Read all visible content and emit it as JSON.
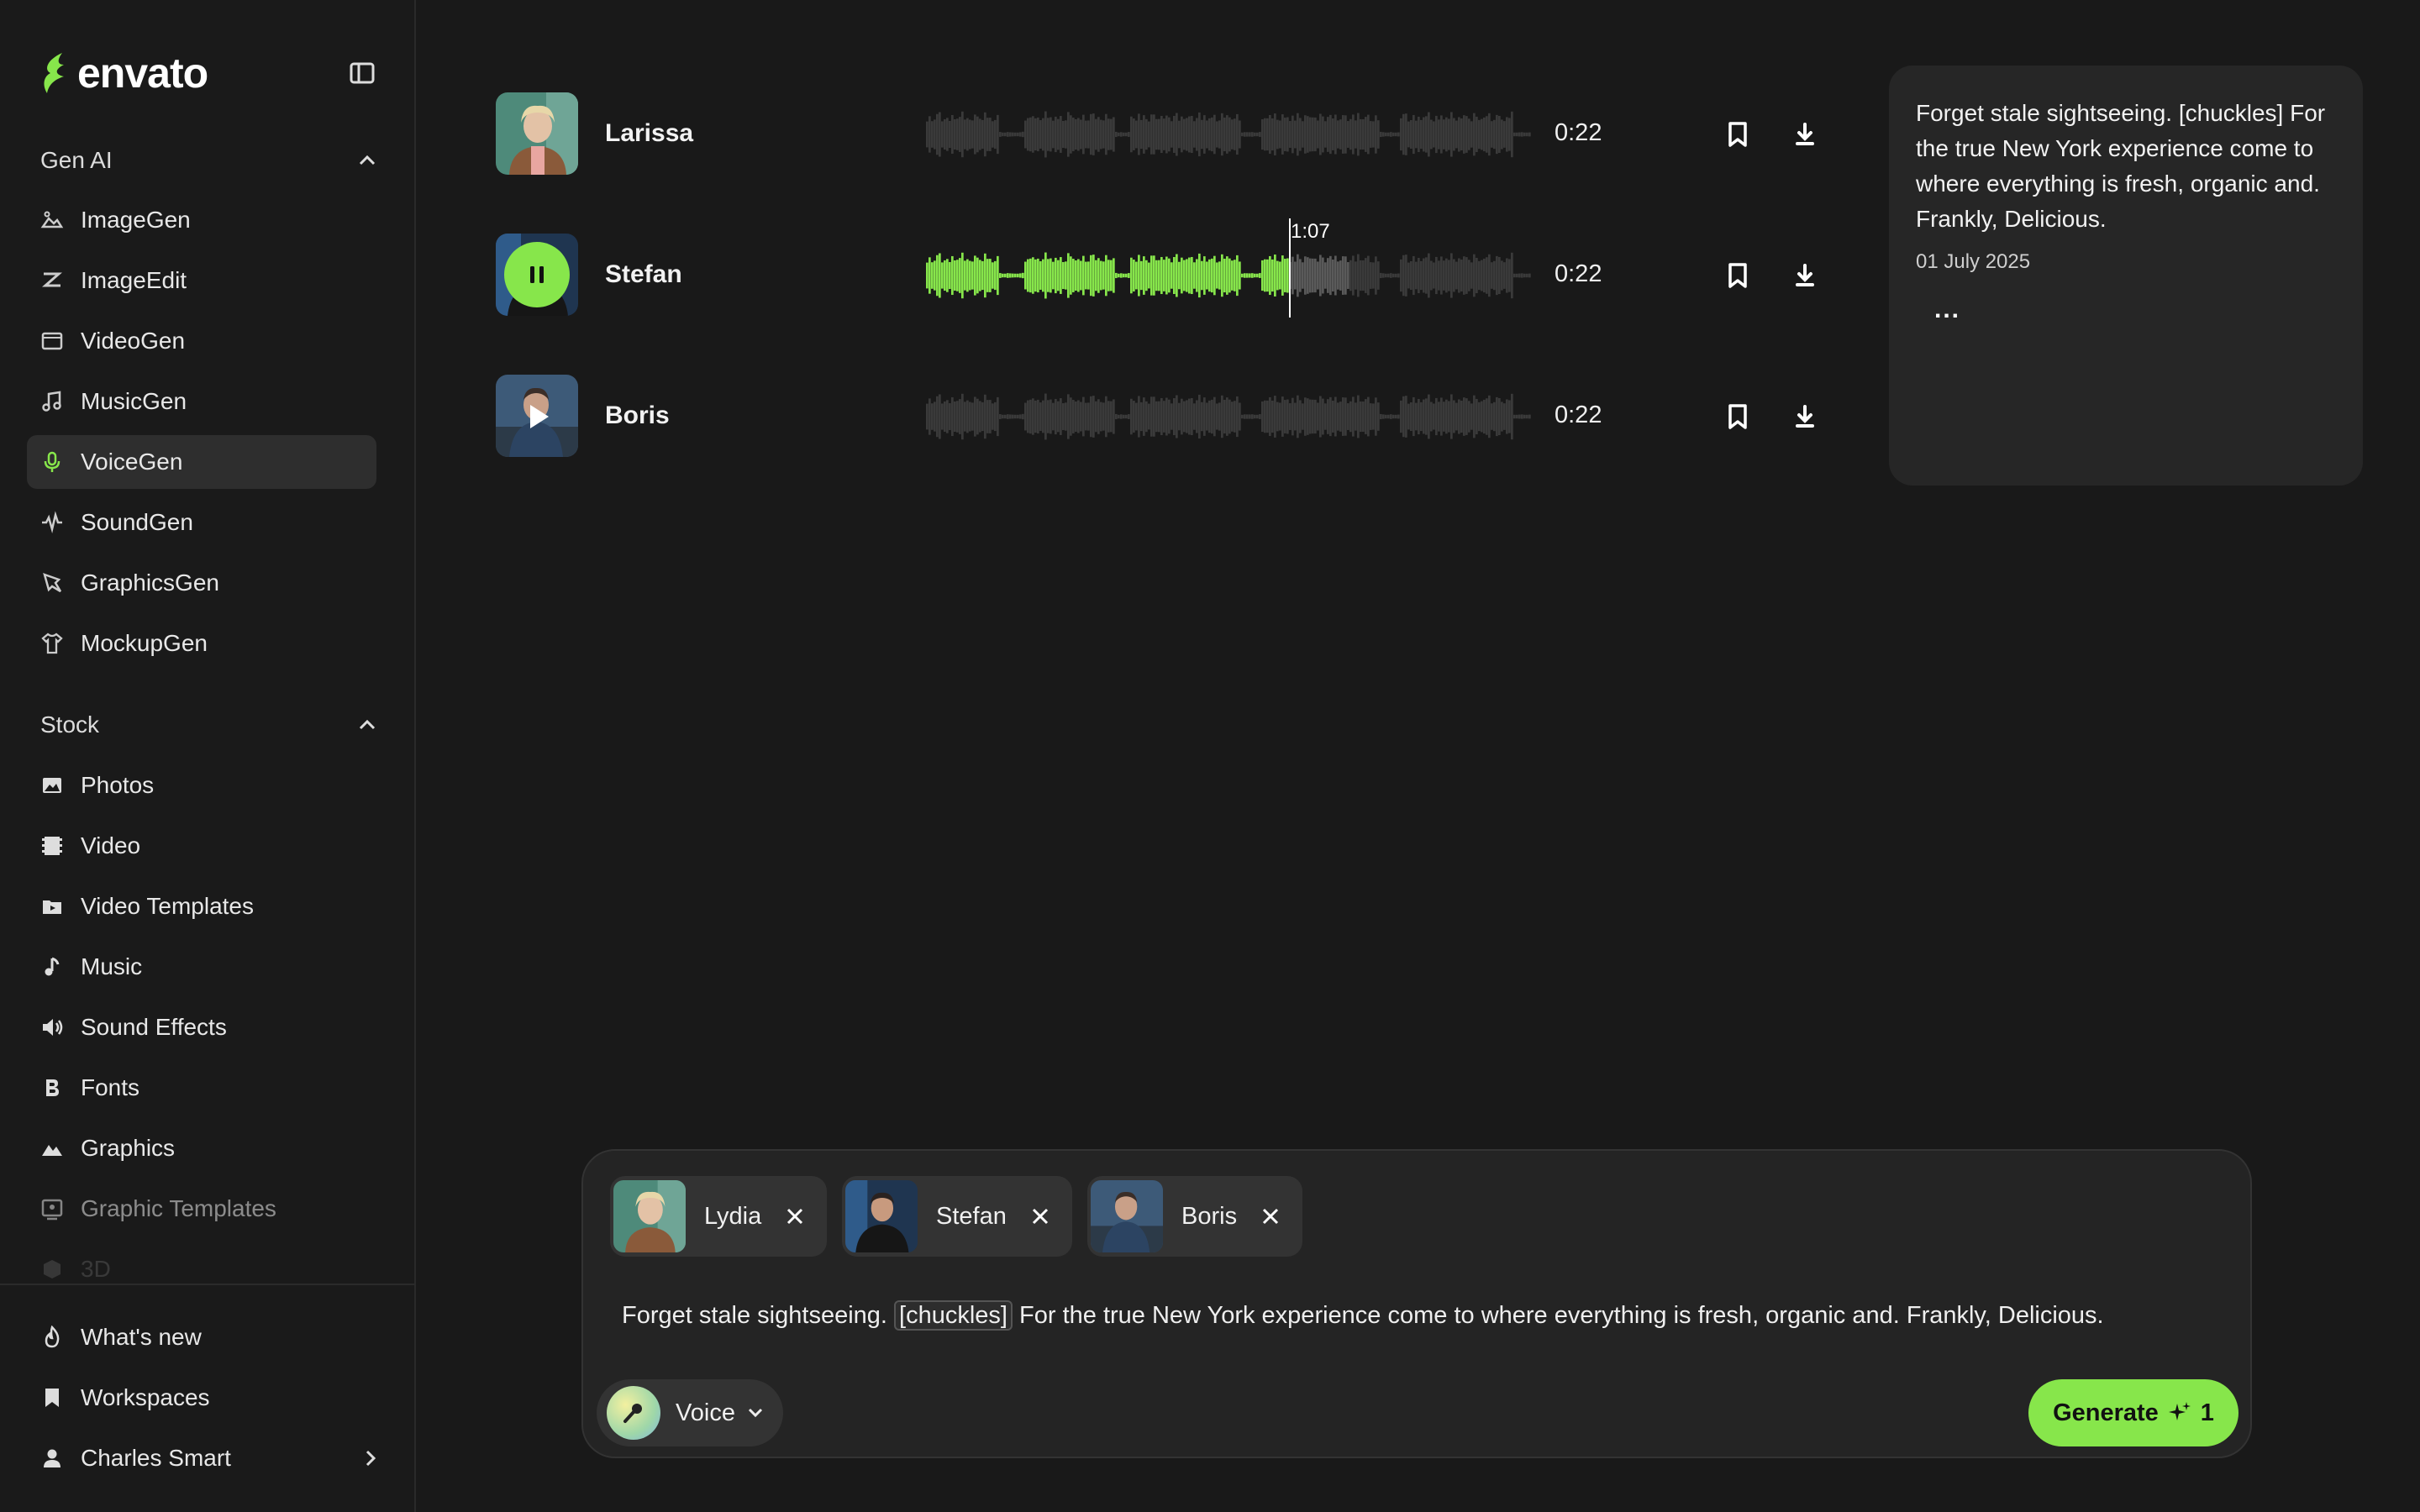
{
  "brand": {
    "name": "envato",
    "accent": "#87e64b"
  },
  "sidebar": {
    "gen_ai_label": "Gen AI",
    "gen_ai_items": [
      {
        "label": "ImageGen",
        "icon": "image-gen-icon"
      },
      {
        "label": "ImageEdit",
        "icon": "image-edit-icon"
      },
      {
        "label": "VideoGen",
        "icon": "video-gen-icon"
      },
      {
        "label": "MusicGen",
        "icon": "music-gen-icon"
      },
      {
        "label": "VoiceGen",
        "icon": "mic-icon",
        "active": true
      },
      {
        "label": "SoundGen",
        "icon": "sound-wave-icon"
      },
      {
        "label": "GraphicsGen",
        "icon": "pen-nib-icon"
      },
      {
        "label": "MockupGen",
        "icon": "tshirt-icon"
      }
    ],
    "stock_label": "Stock",
    "stock_items": [
      {
        "label": "Photos",
        "icon": "photo-icon"
      },
      {
        "label": "Video",
        "icon": "film-icon"
      },
      {
        "label": "Video Templates",
        "icon": "video-folder-icon"
      },
      {
        "label": "Music",
        "icon": "music-note-icon"
      },
      {
        "label": "Sound Effects",
        "icon": "speaker-icon"
      },
      {
        "label": "Fonts",
        "icon": "bold-b-icon"
      },
      {
        "label": "Graphics",
        "icon": "mountain-icon"
      },
      {
        "label": "Graphic Templates",
        "icon": "template-icon"
      },
      {
        "label": "3D",
        "icon": "cube-icon"
      }
    ],
    "bottom_items": [
      {
        "label": "What's new",
        "icon": "flame-icon"
      },
      {
        "label": "Workspaces",
        "icon": "bookmark-icon"
      },
      {
        "label": "Charles Smart",
        "icon": "user-icon"
      }
    ]
  },
  "tracks": [
    {
      "name": "Larissa",
      "duration": "0:22",
      "state": "idle"
    },
    {
      "name": "Stefan",
      "duration": "0:22",
      "state": "playing",
      "progress": 0.6,
      "buffered": 0.7,
      "playhead_time": "1:07"
    },
    {
      "name": "Boris",
      "duration": "0:22",
      "state": "paused"
    }
  ],
  "info_panel": {
    "text": "Forget stale sightseeing. [chuckles] For the true New York experience come to where everything is fresh, organic and. Frankly, Delicious.",
    "date": "01 July 2025",
    "more": "..."
  },
  "composer": {
    "voices": [
      {
        "name": "Lydia"
      },
      {
        "name": "Stefan"
      },
      {
        "name": "Boris"
      }
    ],
    "prompt_before": "Forget stale sightseeing. ",
    "prompt_tag": "[chuckles]",
    "prompt_after": " For the true New York experience come to where everything is fresh, organic and. Frankly, Delicious.",
    "voice_button": "Voice",
    "generate_label": "Generate",
    "generate_cost": "1"
  }
}
